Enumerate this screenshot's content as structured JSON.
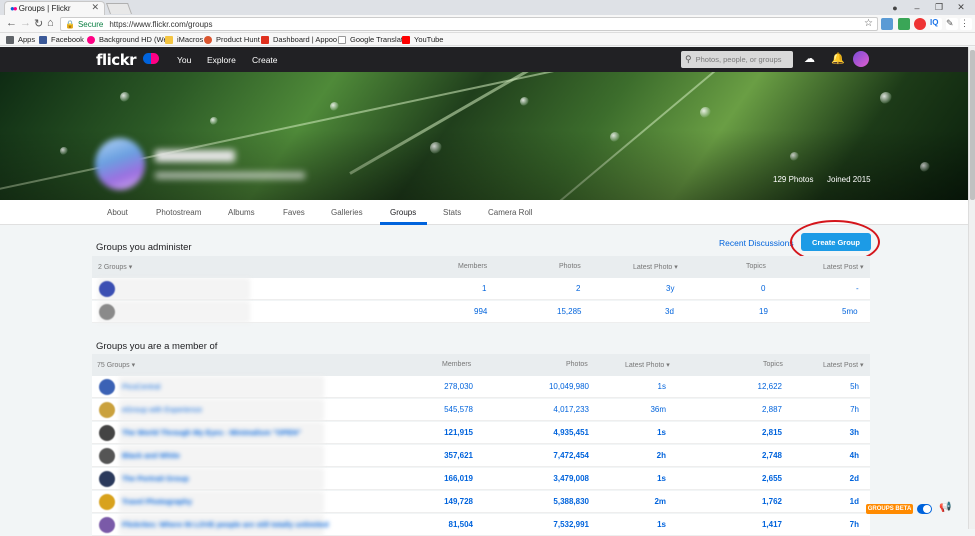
{
  "browser": {
    "tab_title": "Groups | Flickr",
    "secure_label": "Secure",
    "url": "https://www.flickr.com/groups",
    "bookmarks": [
      {
        "label": "Apps",
        "icon": "apps-grid-icon",
        "color": "#5f6368"
      },
      {
        "label": "Facebook",
        "icon": "facebook-icon",
        "color": "#3b5998"
      },
      {
        "label": "Background HD (We",
        "icon": "flickr-dots-icon",
        "color": "#ff0084"
      },
      {
        "label": "iMacros",
        "icon": "imacros-icon",
        "color": "#f4c542"
      },
      {
        "label": "Product Hunt",
        "icon": "product-hunt-icon",
        "color": "#da552f"
      },
      {
        "label": "Dashboard | Appoo",
        "icon": "dashboard-icon",
        "color": "#e0301e"
      },
      {
        "label": "Google Translate",
        "icon": "page-icon",
        "color": "#bbbbbb"
      },
      {
        "label": "YouTube",
        "icon": "youtube-icon",
        "color": "#ff0000"
      }
    ]
  },
  "flickr_nav": {
    "logo": "flickr",
    "links": [
      "You",
      "Explore",
      "Create"
    ],
    "search_placeholder": "Photos, people, or groups"
  },
  "profile": {
    "photos": "129 Photos",
    "joined": "Joined 2015"
  },
  "subnav": {
    "tabs": [
      "About",
      "Photostream",
      "Albums",
      "Faves",
      "Galleries",
      "Groups",
      "Stats",
      "Camera Roll"
    ],
    "active": "Groups"
  },
  "administer": {
    "heading": "Groups you administer",
    "recent_discussions": "Recent Discussions",
    "create_group": "Create Group",
    "columns": {
      "count": "2 Groups ▾",
      "members": "Members",
      "photos": "Photos",
      "latest_photo": "Latest Photo ▾",
      "topics": "Topics",
      "latest_post": "Latest Post ▾"
    },
    "rows": [
      {
        "members": "1",
        "photos": "2",
        "latest_photo": "3y",
        "topics": "0",
        "latest_post": "-"
      },
      {
        "members": "994",
        "photos": "15,285",
        "latest_photo": "3d",
        "topics": "19",
        "latest_post": "5mo"
      }
    ]
  },
  "member": {
    "heading": "Groups you are a member of",
    "columns": {
      "count": "75 Groups ▾",
      "members": "Members",
      "photos": "Photos",
      "latest_photo": "Latest Photo ▾",
      "topics": "Topics",
      "latest_post": "Latest Post ▾"
    },
    "rows": [
      {
        "name": "PicsCentral",
        "members": "278,030",
        "photos": "10,049,980",
        "latest_photo": "1s",
        "topics": "12,622",
        "latest_post": "5h",
        "bold": false,
        "color": "#3b62b5"
      },
      {
        "name": "eGroup with Experience",
        "members": "545,578",
        "photos": "4,017,233",
        "latest_photo": "36m",
        "topics": "2,887",
        "latest_post": "7h",
        "bold": false,
        "color": "#caa13d"
      },
      {
        "name": "The World Through My Eyes - Minimalism \"OPEN\"",
        "members": "121,915",
        "photos": "4,935,451",
        "latest_photo": "1s",
        "topics": "2,815",
        "latest_post": "3h",
        "bold": true,
        "color": "#444444"
      },
      {
        "name": "Black and White",
        "members": "357,621",
        "photos": "7,472,454",
        "latest_photo": "2h",
        "topics": "2,748",
        "latest_post": "4h",
        "bold": true,
        "color": "#555555"
      },
      {
        "name": "The Portrait Group",
        "members": "166,019",
        "photos": "3,479,008",
        "latest_photo": "1s",
        "topics": "2,655",
        "latest_post": "2d",
        "bold": true,
        "color": "#2b3a5c"
      },
      {
        "name": "Travel Photography",
        "members": "149,728",
        "photos": "5,388,830",
        "latest_photo": "2m",
        "topics": "1,762",
        "latest_post": "1d",
        "bold": true,
        "color": "#d8a21c"
      },
      {
        "name": "Flickrites: Where IN LOVE people are still totally unlimited",
        "members": "81,504",
        "photos": "7,532,991",
        "latest_photo": "1s",
        "topics": "1,417",
        "latest_post": "7h",
        "bold": true,
        "color": "#7a5aa8"
      }
    ]
  },
  "footer_widget": {
    "beta_label": "GROUPS BETA"
  },
  "colors": {
    "flickr_blue": "#0063dc",
    "flickr_pink": "#ff0084",
    "nav_bg": "#212124",
    "create_button": "#1c9be6",
    "highlight_ring": "#d4151b"
  }
}
